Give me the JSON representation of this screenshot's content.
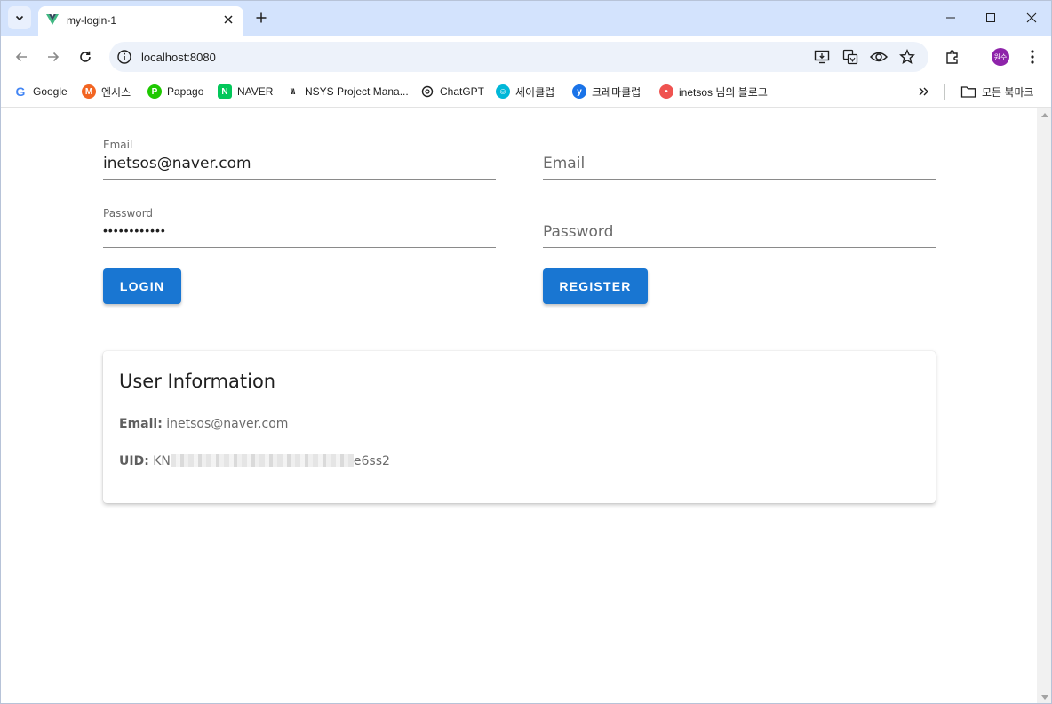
{
  "browser": {
    "tab_title": "my-login-1",
    "url": "localhost:8080",
    "profile_label": "원수",
    "bookmarks": [
      {
        "label": "Google",
        "icon": "google-icon",
        "color": "#4285f4"
      },
      {
        "label": "엔시스",
        "icon": "m-logo-icon",
        "color": "#f26522"
      },
      {
        "label": "Papago",
        "icon": "papago-icon",
        "color": "#1ec800"
      },
      {
        "label": "NAVER",
        "icon": "naver-icon",
        "color": "#03c75a"
      },
      {
        "label": "NSYS Project Mana...",
        "icon": "nsys-icon",
        "color": "#f4b400"
      },
      {
        "label": "ChatGPT",
        "icon": "chatgpt-icon",
        "color": "#1f1f1f"
      },
      {
        "label": "세이클럽",
        "icon": "sayclub-icon",
        "color": "#00b7d8"
      },
      {
        "label": "크레마클럽",
        "icon": "yes24-icon",
        "color": "#1a73e8"
      },
      {
        "label": "inetsos 님의 블로그",
        "icon": "blog-icon",
        "color": "#ef5350"
      }
    ],
    "all_bookmarks_label": "모든 북마크"
  },
  "login": {
    "email_label": "Email",
    "email_value": "inetsos@naver.com",
    "password_label": "Password",
    "password_mask": "••••••••••••",
    "button_label": "LOGIN"
  },
  "register": {
    "email_placeholder": "Email",
    "password_placeholder": "Password",
    "button_label": "REGISTER"
  },
  "user_info": {
    "title": "User Information",
    "email_label": "Email:",
    "email_value": "inetsos@naver.com",
    "uid_label": "UID:",
    "uid_prefix": "KN",
    "uid_suffix": "e6ss2"
  },
  "colors": {
    "primary": "#1976d2",
    "tabstrip": "#d3e3fd"
  }
}
